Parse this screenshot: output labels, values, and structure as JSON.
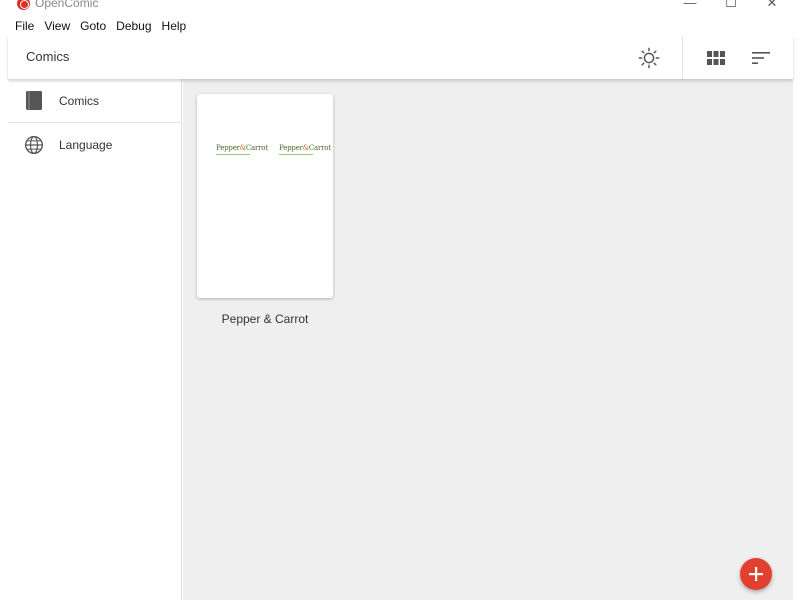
{
  "window": {
    "title": "OpenComic",
    "controls": {
      "minimize": "—",
      "maximize": "☐",
      "close": "✕"
    }
  },
  "menu": {
    "items": [
      "File",
      "View",
      "Goto",
      "Debug",
      "Help"
    ]
  },
  "header": {
    "title": "Comics",
    "actions": {
      "theme_icon": "brightness-icon",
      "view_icon": "grid-view-icon",
      "sort_icon": "sort-icon"
    }
  },
  "sidebar": {
    "items": [
      {
        "label": "Comics",
        "icon": "book-icon"
      },
      {
        "label": "Language",
        "icon": "globe-icon"
      }
    ]
  },
  "library": {
    "comics": [
      {
        "title": "Pepper & Carrot",
        "cover_text_a": "Pepper",
        "cover_amp": "&",
        "cover_text_b": "Carrot"
      }
    ]
  },
  "fab": {
    "label": "+",
    "icon": "add-icon",
    "color": "#e2402f"
  },
  "colors": {
    "accent": "#e2402f",
    "content_bg": "#efefef"
  }
}
